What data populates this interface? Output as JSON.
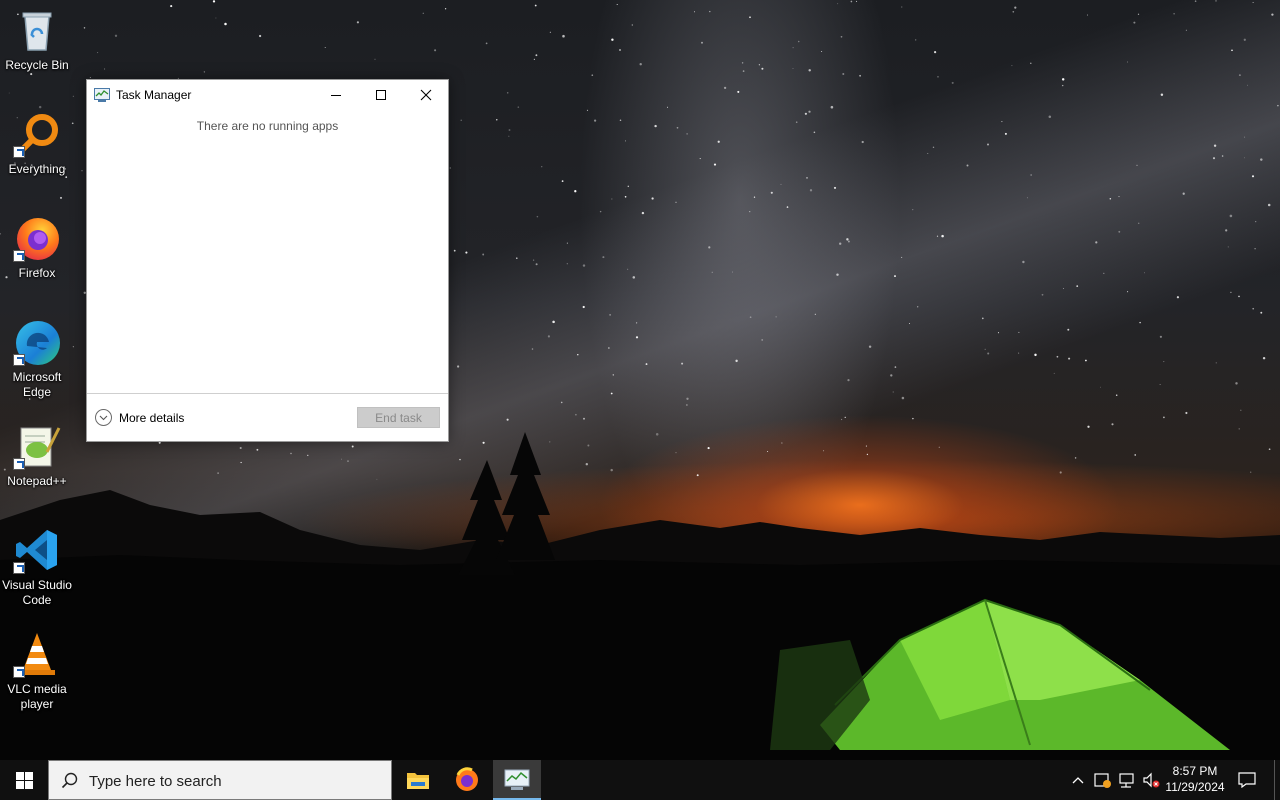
{
  "desktop": {
    "icons": [
      {
        "label": "Recycle Bin"
      },
      {
        "label": "Everything"
      },
      {
        "label": "Firefox"
      },
      {
        "label": "Microsoft Edge"
      },
      {
        "label": "Notepad++"
      },
      {
        "label": "Visual Studio Code"
      },
      {
        "label": "VLC media player"
      }
    ]
  },
  "task_manager": {
    "title": "Task Manager",
    "empty_message": "There are no running apps",
    "more_details_label": "More details",
    "end_task_label": "End task"
  },
  "taskbar": {
    "search_placeholder": "Type here to search",
    "pinned": [
      "file-explorer",
      "firefox",
      "task-manager"
    ],
    "active_app": "task-manager",
    "clock": {
      "time": "8:57 PM",
      "date": "11/29/2024"
    }
  },
  "colors": {
    "taskbar_bg": "#101010",
    "active_indicator": "#76b9ed",
    "end_task_disabled_bg": "#cccccc"
  }
}
